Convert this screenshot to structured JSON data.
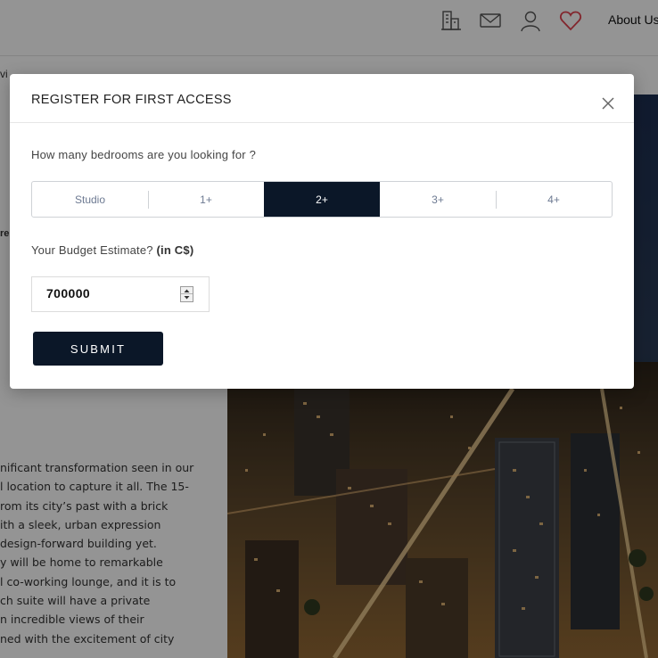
{
  "nav": {
    "icons": [
      "building-icon",
      "mail-icon",
      "user-icon",
      "heart-icon"
    ],
    "about_label": "About Us"
  },
  "background": {
    "edge_text_1": "vi",
    "edge_text_2": "re",
    "article_lines": [
      "nificant transformation seen in our",
      "l location to capture it all. The 15-",
      "rom its city’s past with a brick",
      "ith a sleek, urban expression",
      " design-forward building yet.",
      "y will be home to remarkable",
      "l co-working lounge, and it is to",
      "ch suite will have a private",
      "n incredible views of their",
      "ned with the excitement of city"
    ]
  },
  "modal": {
    "title": "REGISTER FOR FIRST ACCESS",
    "question": "How many bedrooms are you looking for ?",
    "bedroom_options": [
      {
        "label": "Studio",
        "selected": false
      },
      {
        "label": "1+",
        "selected": false
      },
      {
        "label": "2+",
        "selected": true
      },
      {
        "label": "3+",
        "selected": false
      },
      {
        "label": "4+",
        "selected": false
      }
    ],
    "budget_label": "Your Budget Estimate?",
    "budget_unit": "(in C$)",
    "budget_value": "700000",
    "submit_label": "SUBMIT"
  },
  "colors": {
    "accent_navy": "#0b1728",
    "heart_red": "#e0424f",
    "option_text": "#6d7a92"
  }
}
